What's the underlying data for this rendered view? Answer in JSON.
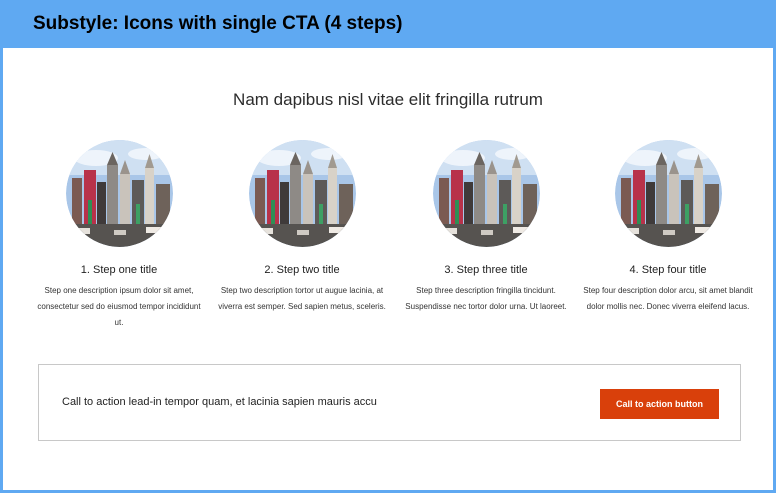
{
  "header": {
    "title": "Substyle: Icons with single CTA (4 steps)"
  },
  "section": {
    "heading": "Nam dapibus nisl vitae elit fringilla rutrum"
  },
  "steps": [
    {
      "title": "1. Step one title",
      "description": "Step one description ipsum dolor sit amet, consectetur sed do eiusmod tempor incididunt ut."
    },
    {
      "title": "2. Step two title",
      "description": "Step two description tortor ut augue lacinia, at viverra est semper. Sed sapien metus, sceleris."
    },
    {
      "title": "3. Step three title",
      "description": "Step three description fringilla tincidunt. Suspendisse nec tortor dolor urna. Ut laoreet."
    },
    {
      "title": "4. Step four title",
      "description": "Step four description dolor arcu, sit amet blandit dolor mollis nec. Donec viverra eleifend lacus."
    }
  ],
  "cta": {
    "lead_in": "Call to action lead-in tempor quam, et lacinia sapien mauris accu",
    "button_label": "Call to action button"
  },
  "colors": {
    "header_bar": "#5fa9f2",
    "cta_button": "#d9400b",
    "frame_border": "#5fa9f2"
  },
  "icons": {
    "step_image": "city-skyline-photo-icon"
  }
}
